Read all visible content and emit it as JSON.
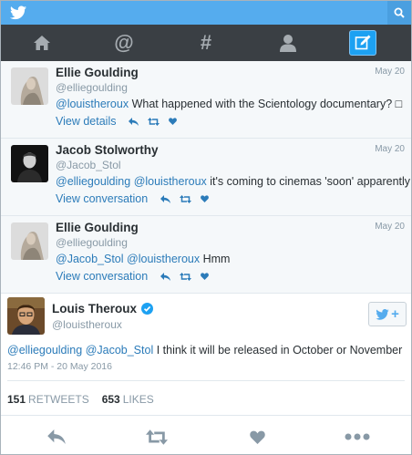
{
  "colors": {
    "brand": "#55acee",
    "nav_bg": "#3a3f44",
    "link": "#2b7bb9",
    "muted": "#8899a6"
  },
  "topbar": {
    "logo_icon": "twitter-bird-icon",
    "search_icon": "search-icon"
  },
  "nav": {
    "items": [
      {
        "icon": "home-icon"
      },
      {
        "icon": "at-sign-icon",
        "glyph": "@"
      },
      {
        "icon": "hashtag-icon",
        "glyph": "#"
      },
      {
        "icon": "profile-icon"
      },
      {
        "icon": "compose-icon"
      }
    ]
  },
  "tweets": [
    {
      "name": "Ellie Goulding",
      "handle": "@elliegoulding",
      "date": "May 20",
      "mentions": [
        "@louistheroux"
      ],
      "text": " What happened with the Scientology documentary? □",
      "link": "View details"
    },
    {
      "name": "Jacob Stolworthy",
      "handle": "@Jacob_Stol",
      "date": "May 20",
      "mentions": [
        "@elliegoulding",
        "@louistheroux"
      ],
      "text": " it's coming to cinemas 'soon' apparently",
      "link": "View conversation"
    },
    {
      "name": "Ellie Goulding",
      "handle": "@elliegoulding",
      "date": "May 20",
      "mentions": [
        "@Jacob_Stol",
        "@louistheroux"
      ],
      "text": " Hmm",
      "link": "View conversation"
    }
  ],
  "main_tweet": {
    "name": "Louis Theroux",
    "handle": "@louistheroux",
    "follow_label": "+",
    "mentions": [
      "@elliegoulding",
      "@Jacob_Stol"
    ],
    "text": " I think it will be released in October or November",
    "timestamp": "12:46 PM - 20 May 2016",
    "retweets_count": "151",
    "retweets_label": "RETWEETS",
    "likes_count": "653",
    "likes_label": "LIKES"
  }
}
